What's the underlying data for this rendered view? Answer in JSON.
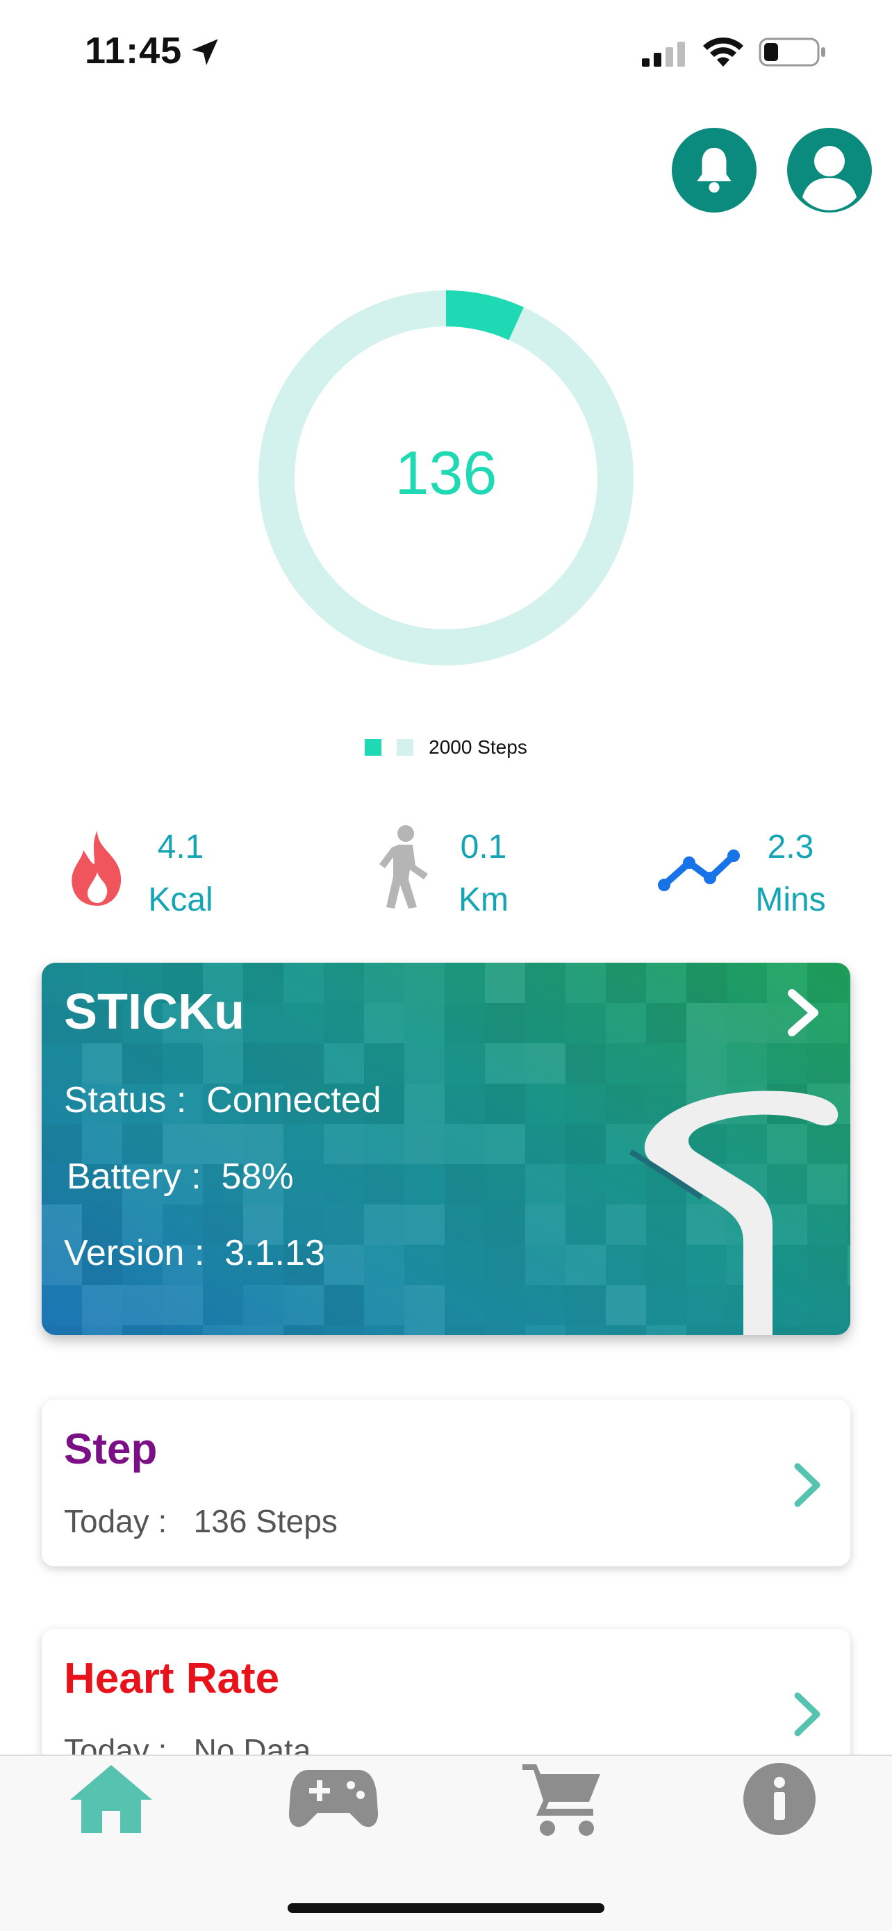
{
  "status_bar": {
    "time": "11:45"
  },
  "header": {
    "notification_icon": "bell-icon",
    "profile_icon": "user-icon"
  },
  "activity_ring": {
    "current_steps": "136",
    "goal_label": "2000 Steps",
    "progress_fraction": 0.068,
    "colors": {
      "progress": "#1fd8b4",
      "track": "#d3f2ee"
    }
  },
  "stats": [
    {
      "icon": "flame-icon",
      "value": "4.1",
      "unit": "Kcal"
    },
    {
      "icon": "walking-person-icon",
      "value": "0.1",
      "unit": "Km"
    },
    {
      "icon": "trend-line-icon",
      "value": "2.3",
      "unit": "Mins"
    }
  ],
  "device": {
    "name": "STICKu",
    "status_label": "Status :",
    "status_value": "Connected",
    "battery_label": "Battery :",
    "battery_value": "58%",
    "version_label": "Version :",
    "version_value": "3.1.13"
  },
  "cards": [
    {
      "title": "Step",
      "sub_label": "Today :",
      "sub_value": "136 Steps",
      "title_color": "#7b0f86"
    },
    {
      "title": "Heart Rate",
      "sub_label": "Today :",
      "sub_value": "No Data",
      "title_color": "#e8121b"
    }
  ],
  "tabbar": {
    "items": [
      {
        "icon": "home-icon",
        "active": true
      },
      {
        "icon": "gamepad-icon",
        "active": false
      },
      {
        "icon": "cart-icon",
        "active": false
      },
      {
        "icon": "info-icon",
        "active": false
      }
    ],
    "colors": {
      "active": "#55c3b0",
      "inactive": "#8d8d8d"
    }
  }
}
